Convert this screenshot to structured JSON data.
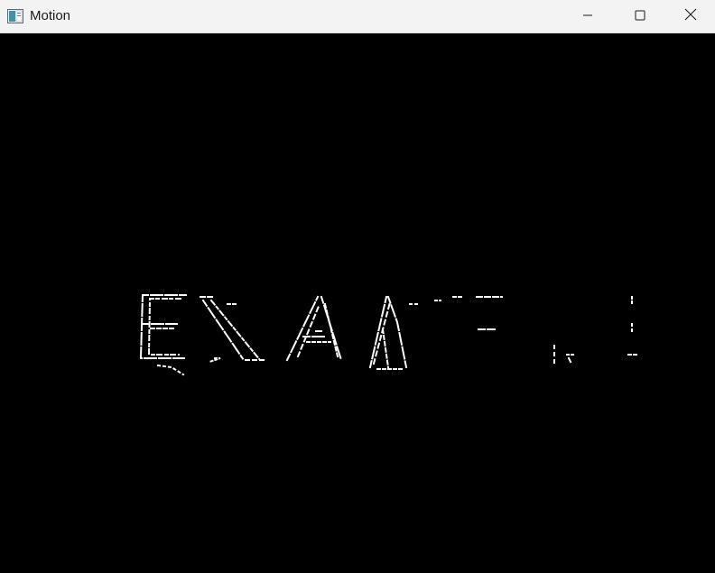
{
  "window": {
    "title": "Motion",
    "app_icon": "window-app-icon",
    "controls": {
      "minimize_icon": "minimize-icon",
      "maximize_icon": "maximize-icon",
      "close_icon": "close-icon"
    }
  },
  "content": {
    "background_color": "#000000",
    "foreground_color": "#ffffff"
  }
}
